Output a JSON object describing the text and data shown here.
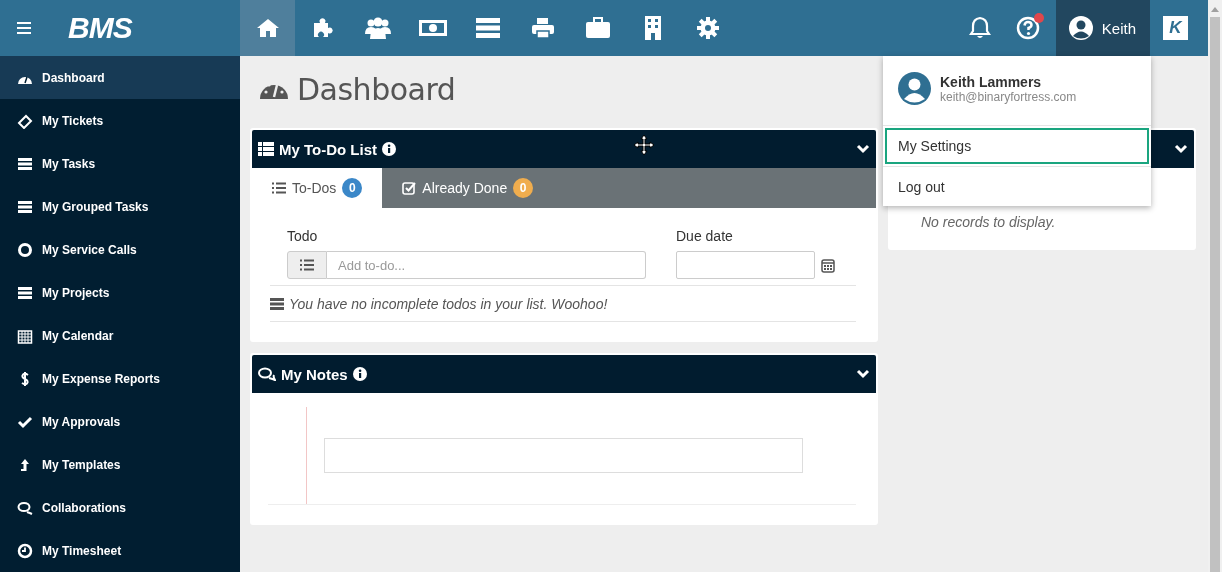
{
  "topbar": {
    "logo": "BMS",
    "nav": [
      {
        "selected": true
      },
      {
        "selected": false
      },
      {
        "selected": false
      },
      {
        "selected": false
      },
      {
        "selected": false
      },
      {
        "selected": false
      },
      {
        "selected": false
      },
      {
        "selected": false
      },
      {
        "selected": false
      }
    ],
    "help_alert": true,
    "user": {
      "name": "Keith",
      "expanded": true
    },
    "app_logo": "K"
  },
  "sidebar": {
    "items": [
      {
        "label": "Dashboard",
        "selected": true
      },
      {
        "label": "My Tickets",
        "selected": false
      },
      {
        "label": "My Tasks",
        "selected": false
      },
      {
        "label": "My Grouped Tasks",
        "selected": false
      },
      {
        "label": "My Service Calls",
        "selected": false
      },
      {
        "label": "My Projects",
        "selected": false
      },
      {
        "label": "My Calendar",
        "selected": false
      },
      {
        "label": "My Expense Reports",
        "selected": false
      },
      {
        "label": "My Approvals",
        "selected": false
      },
      {
        "label": "My Templates",
        "selected": false
      },
      {
        "label": "Collaborations",
        "selected": false
      },
      {
        "label": "My Timesheet",
        "selected": false
      }
    ]
  },
  "page_title": "Dashboard",
  "todo_widget": {
    "title": "My To-Do List",
    "tabs": [
      {
        "label": "To-Dos",
        "count": "0",
        "color": "#3a87c8",
        "selected": true
      },
      {
        "label": "Already Done",
        "count": "0",
        "color": "#f0ad4e",
        "selected": false
      }
    ],
    "todo_label": "Todo",
    "todo_placeholder": "Add to-do...",
    "due_label": "Due date",
    "empty_message": "You have no incomplete todos in your list. Woohoo!"
  },
  "notes_widget": {
    "title": "My Notes"
  },
  "side_widget": {
    "empty_message": "No records to display."
  },
  "user_menu": {
    "name": "Keith Lammers",
    "email": "keith@binaryfortress.com",
    "items": [
      {
        "label": "My Settings",
        "focused": true
      },
      {
        "label": "Log out",
        "focused": false
      }
    ]
  }
}
